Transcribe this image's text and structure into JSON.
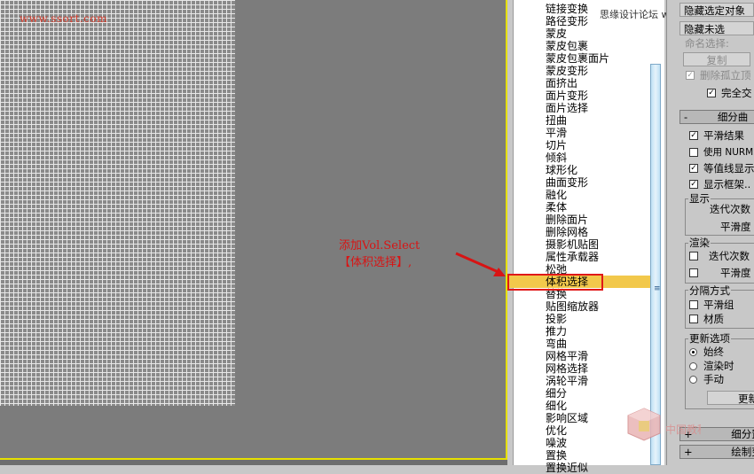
{
  "viewport": {
    "watermark": "www.ssort.com",
    "annotation_line1": "添加Vol.Select",
    "annotation_line2": "【体积选择】,"
  },
  "modifier_list": [
    "链接变换",
    "路径变形",
    "蒙皮",
    "蒙皮包裹",
    "蒙皮包裹面片",
    "蒙皮变形",
    "面挤出",
    "面片变形",
    "面片选择",
    "扭曲",
    "平滑",
    "切片",
    "倾斜",
    "球形化",
    "曲面变形",
    "融化",
    "柔体",
    "删除面片",
    "删除网格",
    "摄影机贴图",
    "属性承载器",
    "松弛",
    "体积选择",
    "替换",
    "贴图缩放器",
    "投影",
    "推力",
    "弯曲",
    "网格平滑",
    "网格选择",
    "涡轮平滑",
    "细分",
    "细化",
    "影响区域",
    "优化",
    "噪波",
    "置换",
    "置换近似"
  ],
  "selected_modifier": "体积选择",
  "site_label": "思缘设计论坛 www.missyuan.com",
  "right_panel": {
    "hide_selected": "隐藏选定对象",
    "hide_unselected": "隐藏未选",
    "named_selection": "命名选择:",
    "copy": "复制",
    "delete_isolated": "删除孤立顶",
    "full_interaction": "完全交",
    "rollout_subdivision": "细分曲",
    "smooth_result": "平滑结果",
    "use_nurms": "使用 NURMS",
    "isoline_display": "等值线显示",
    "show_cage": "显示框架..",
    "display_group": "显示",
    "iterations": "迭代次数",
    "smoothness": "平滑度",
    "render_group": "渲染",
    "r_iterations": "迭代次数",
    "r_smoothness": "平滑度",
    "separate_by": "分隔方式",
    "smoothing_groups": "平滑组",
    "materials": "材质",
    "update_options": "更新选项",
    "always": "始终",
    "when_rendering": "渲染时",
    "manually": "手动",
    "update": "更新",
    "rollout_subdiv_displace": "细分置",
    "rollout_paint_deform": "绘制变"
  },
  "logo_text": "中国教程网"
}
